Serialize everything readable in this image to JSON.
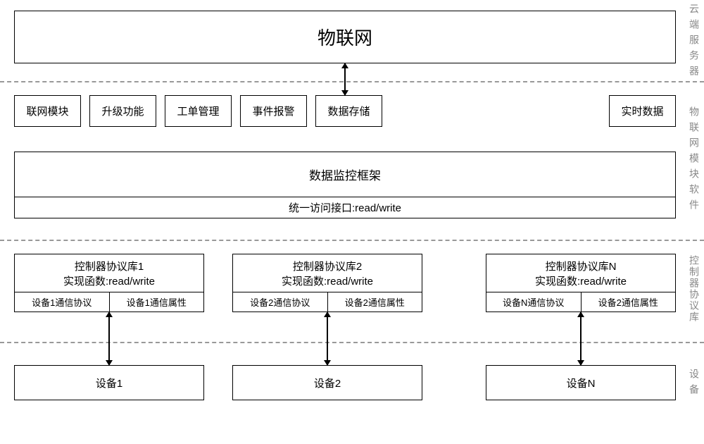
{
  "layers": {
    "cloud": {
      "title": "物联网",
      "sideLabel": "云端服务器"
    },
    "software": {
      "modules": [
        "联网模块",
        "升级功能",
        "工单管理",
        "事件报警",
        "数据存储"
      ],
      "rightModule": "实时数据",
      "framework": "数据监控框架",
      "interface": "统一访问接口:read/write",
      "sideLabel": "物联网模块软件"
    },
    "controllers": {
      "sideLabel": "控制器协议库",
      "items": [
        {
          "title": "控制器协议库1",
          "func": "实现函数:read/write",
          "protocol": "设备1通信协议",
          "attr": "设备1通信属性"
        },
        {
          "title": "控制器协议库2",
          "func": "实现函数:read/write",
          "protocol": "设备2通信协议",
          "attr": "设备2通信属性"
        },
        {
          "title": "控制器协议库N",
          "func": "实现函数:read/write",
          "protocol": "设备N通信协议",
          "attr": "设备2通信属性"
        }
      ]
    },
    "devices": {
      "sideLabel": "设备",
      "items": [
        "设备1",
        "设备2",
        "设备N"
      ]
    }
  }
}
